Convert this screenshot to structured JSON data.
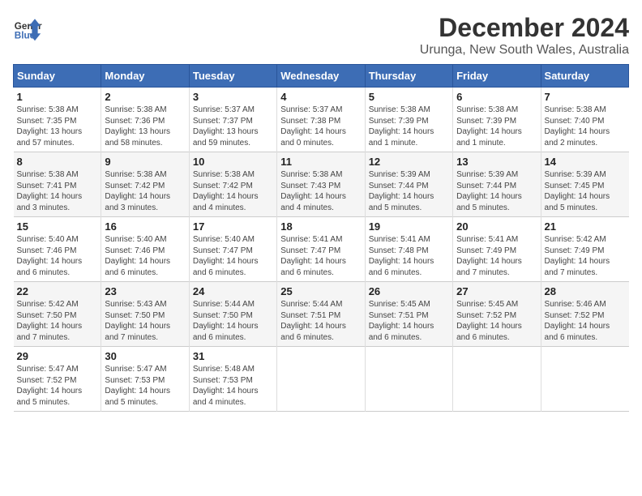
{
  "header": {
    "logo_line1": "General",
    "logo_line2": "Blue",
    "month": "December 2024",
    "location": "Urunga, New South Wales, Australia"
  },
  "days_of_week": [
    "Sunday",
    "Monday",
    "Tuesday",
    "Wednesday",
    "Thursday",
    "Friday",
    "Saturday"
  ],
  "weeks": [
    [
      {
        "day": "1",
        "info": "Sunrise: 5:38 AM\nSunset: 7:35 PM\nDaylight: 13 hours\nand 57 minutes."
      },
      {
        "day": "2",
        "info": "Sunrise: 5:38 AM\nSunset: 7:36 PM\nDaylight: 13 hours\nand 58 minutes."
      },
      {
        "day": "3",
        "info": "Sunrise: 5:37 AM\nSunset: 7:37 PM\nDaylight: 13 hours\nand 59 minutes."
      },
      {
        "day": "4",
        "info": "Sunrise: 5:37 AM\nSunset: 7:38 PM\nDaylight: 14 hours\nand 0 minutes."
      },
      {
        "day": "5",
        "info": "Sunrise: 5:38 AM\nSunset: 7:39 PM\nDaylight: 14 hours\nand 1 minute."
      },
      {
        "day": "6",
        "info": "Sunrise: 5:38 AM\nSunset: 7:39 PM\nDaylight: 14 hours\nand 1 minute."
      },
      {
        "day": "7",
        "info": "Sunrise: 5:38 AM\nSunset: 7:40 PM\nDaylight: 14 hours\nand 2 minutes."
      }
    ],
    [
      {
        "day": "8",
        "info": "Sunrise: 5:38 AM\nSunset: 7:41 PM\nDaylight: 14 hours\nand 3 minutes."
      },
      {
        "day": "9",
        "info": "Sunrise: 5:38 AM\nSunset: 7:42 PM\nDaylight: 14 hours\nand 3 minutes."
      },
      {
        "day": "10",
        "info": "Sunrise: 5:38 AM\nSunset: 7:42 PM\nDaylight: 14 hours\nand 4 minutes."
      },
      {
        "day": "11",
        "info": "Sunrise: 5:38 AM\nSunset: 7:43 PM\nDaylight: 14 hours\nand 4 minutes."
      },
      {
        "day": "12",
        "info": "Sunrise: 5:39 AM\nSunset: 7:44 PM\nDaylight: 14 hours\nand 5 minutes."
      },
      {
        "day": "13",
        "info": "Sunrise: 5:39 AM\nSunset: 7:44 PM\nDaylight: 14 hours\nand 5 minutes."
      },
      {
        "day": "14",
        "info": "Sunrise: 5:39 AM\nSunset: 7:45 PM\nDaylight: 14 hours\nand 5 minutes."
      }
    ],
    [
      {
        "day": "15",
        "info": "Sunrise: 5:40 AM\nSunset: 7:46 PM\nDaylight: 14 hours\nand 6 minutes."
      },
      {
        "day": "16",
        "info": "Sunrise: 5:40 AM\nSunset: 7:46 PM\nDaylight: 14 hours\nand 6 minutes."
      },
      {
        "day": "17",
        "info": "Sunrise: 5:40 AM\nSunset: 7:47 PM\nDaylight: 14 hours\nand 6 minutes."
      },
      {
        "day": "18",
        "info": "Sunrise: 5:41 AM\nSunset: 7:47 PM\nDaylight: 14 hours\nand 6 minutes."
      },
      {
        "day": "19",
        "info": "Sunrise: 5:41 AM\nSunset: 7:48 PM\nDaylight: 14 hours\nand 6 minutes."
      },
      {
        "day": "20",
        "info": "Sunrise: 5:41 AM\nSunset: 7:49 PM\nDaylight: 14 hours\nand 7 minutes."
      },
      {
        "day": "21",
        "info": "Sunrise: 5:42 AM\nSunset: 7:49 PM\nDaylight: 14 hours\nand 7 minutes."
      }
    ],
    [
      {
        "day": "22",
        "info": "Sunrise: 5:42 AM\nSunset: 7:50 PM\nDaylight: 14 hours\nand 7 minutes."
      },
      {
        "day": "23",
        "info": "Sunrise: 5:43 AM\nSunset: 7:50 PM\nDaylight: 14 hours\nand 7 minutes."
      },
      {
        "day": "24",
        "info": "Sunrise: 5:44 AM\nSunset: 7:50 PM\nDaylight: 14 hours\nand 6 minutes."
      },
      {
        "day": "25",
        "info": "Sunrise: 5:44 AM\nSunset: 7:51 PM\nDaylight: 14 hours\nand 6 minutes."
      },
      {
        "day": "26",
        "info": "Sunrise: 5:45 AM\nSunset: 7:51 PM\nDaylight: 14 hours\nand 6 minutes."
      },
      {
        "day": "27",
        "info": "Sunrise: 5:45 AM\nSunset: 7:52 PM\nDaylight: 14 hours\nand 6 minutes."
      },
      {
        "day": "28",
        "info": "Sunrise: 5:46 AM\nSunset: 7:52 PM\nDaylight: 14 hours\nand 6 minutes."
      }
    ],
    [
      {
        "day": "29",
        "info": "Sunrise: 5:47 AM\nSunset: 7:52 PM\nDaylight: 14 hours\nand 5 minutes."
      },
      {
        "day": "30",
        "info": "Sunrise: 5:47 AM\nSunset: 7:53 PM\nDaylight: 14 hours\nand 5 minutes."
      },
      {
        "day": "31",
        "info": "Sunrise: 5:48 AM\nSunset: 7:53 PM\nDaylight: 14 hours\nand 4 minutes."
      },
      {
        "day": "",
        "info": ""
      },
      {
        "day": "",
        "info": ""
      },
      {
        "day": "",
        "info": ""
      },
      {
        "day": "",
        "info": ""
      }
    ]
  ]
}
